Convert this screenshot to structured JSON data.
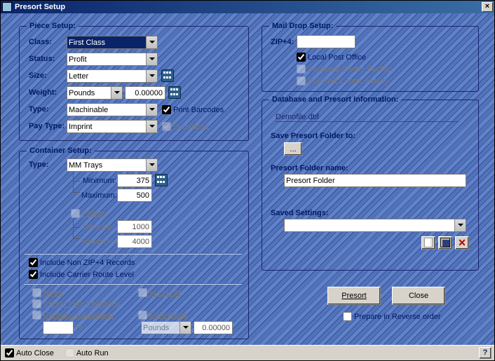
{
  "window": {
    "title": "Presort Setup"
  },
  "piece": {
    "legend": "Piece Setup:",
    "labels": {
      "class": "Class:",
      "status": "Status:",
      "size": "Size:",
      "weight": "Weight:",
      "type": "Type:",
      "paytype": "Pay Type:"
    },
    "values": {
      "class": "First Class",
      "status": "Profit",
      "size": "Letter",
      "weight_unit": "Pounds",
      "weight_val": "0.00000",
      "type": "Machinable",
      "paytype": "Imprint"
    },
    "print_barcodes": "Print Barcodes",
    "surcharge": "Surcharge"
  },
  "container": {
    "legend": "Container Setup:",
    "type_label": "Type:",
    "type_value": "MM Trays",
    "min_label": "Minimum:",
    "max_label": "Maximum:",
    "tray_min": "375",
    "tray_max": "500",
    "pallets": "Pallets",
    "pallet_min": "1000",
    "pallet_max": "4000",
    "include_nonzip4": "Include Non ZIP+4 Records",
    "include_crr": "Include Carrier Route Level",
    "news": "News",
    "incounty": "In-county",
    "firm": "Create Firm Packages",
    "adv": "Contains Advertising",
    "ridealong": "Ride-Along",
    "percent": "%",
    "ra_unit": "Pounds",
    "ra_val": "0.00000"
  },
  "maildrop": {
    "legend": "Mail Drop Setup:",
    "zip4_label": "ZIP+4:",
    "zip4_value": "",
    "local_po": "Local Post Office",
    "scf": "Sectional Center Facility",
    "bmc": "Bulkmail Center Facility"
  },
  "dbinfo": {
    "legend": "Database and Presort Information:",
    "dbfile": "Demofile.dbf",
    "save_to": "Save Presort Folder to:",
    "browse": "...",
    "folder_label": "Presort Folder name:",
    "folder_value": "Presort Folder",
    "saved_label": "Saved Settings:",
    "saved_value": ""
  },
  "actions": {
    "presort": "Presort",
    "close": "Close",
    "reverse": "Prepare in Reverse order"
  },
  "footer": {
    "auto_close": "Auto Close",
    "auto_run": "Auto Run",
    "help": "?"
  }
}
